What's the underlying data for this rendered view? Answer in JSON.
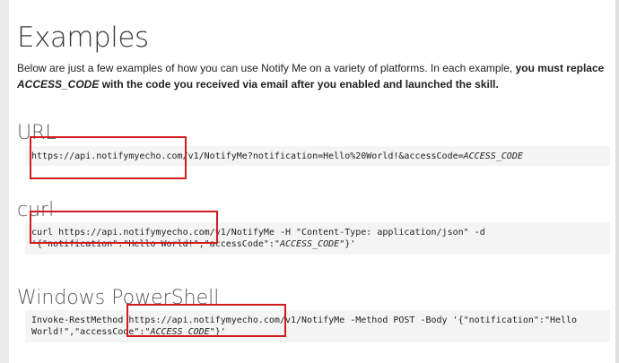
{
  "page": {
    "title": "Examples",
    "intro": {
      "part1": "Below are just a few examples of how you can use Notify Me on a variety of platforms.  In each example, ",
      "bold1": "you must replace ",
      "italic_bold": "ACCESS_CODE",
      "bold2": " with the code you received via email after you enabled and launched the skill."
    }
  },
  "sections": [
    {
      "heading": "URL",
      "code_parts": [
        "https://api.notifymyecho.com/v1/NotifyMe?notification=Hello%20World!&accessCode=",
        "ACCESS_CODE",
        ""
      ]
    },
    {
      "heading": "curl",
      "code_parts": [
        "curl https://api.notifymyecho.com/v1/NotifyMe -H \"Content-Type: application/json\" -d '{\"notification\":\"Hello World!\",\"accessCode\":\"",
        "ACCESS_CODE",
        "\"}'"
      ]
    },
    {
      "heading": "Windows PowerShell",
      "code_parts": [
        "Invoke-RestMethod https://api.notifymyecho.com/v1/NotifyMe -Method POST -Body '{\"notification\":\"Hello World!\",\"accessCode\":\"",
        "ACCESS_CODE",
        "\"}'"
      ]
    }
  ],
  "colors": {
    "annotation": "#d01c1c",
    "code_background": "#f4f4f4"
  }
}
